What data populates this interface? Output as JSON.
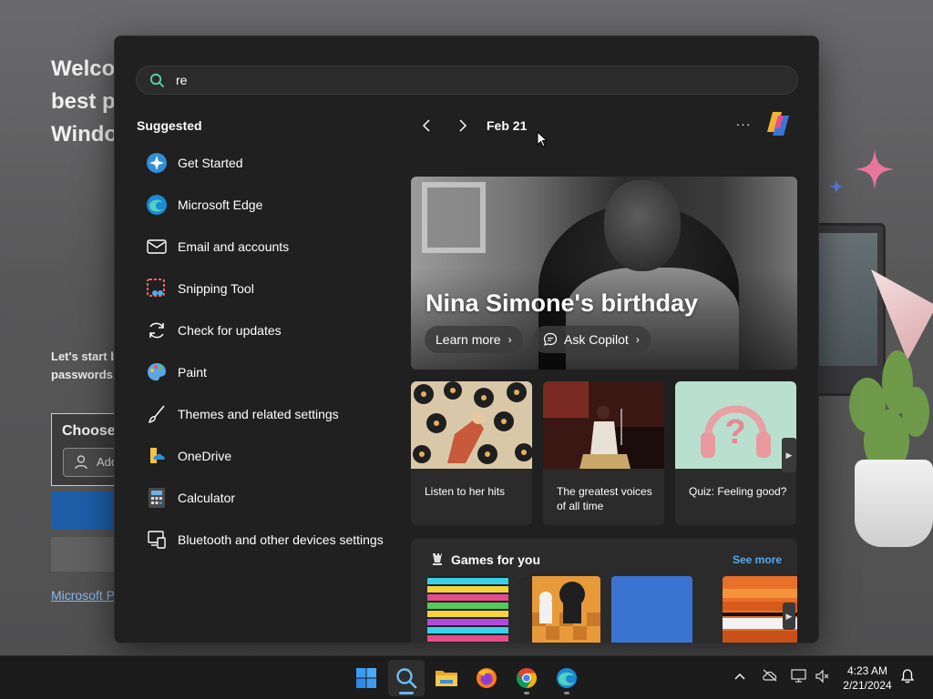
{
  "background_app": {
    "heading": "Welcome to the\nbest place for\nWindows",
    "subtext": "Let's start b\npasswords,",
    "card_title": "Choose",
    "add_button_label": "Add",
    "footer_link": "Microsoft P"
  },
  "search": {
    "query": "re"
  },
  "suggested": {
    "title": "Suggested",
    "items": [
      {
        "label": "Get Started",
        "icon": "get-started-icon"
      },
      {
        "label": "Microsoft Edge",
        "icon": "edge-icon"
      },
      {
        "label": "Email and accounts",
        "icon": "mail-icon"
      },
      {
        "label": "Snipping Tool",
        "icon": "snipping-tool-icon"
      },
      {
        "label": "Check for updates",
        "icon": "refresh-icon"
      },
      {
        "label": "Paint",
        "icon": "paint-icon"
      },
      {
        "label": "Themes and related settings",
        "icon": "brush-icon"
      },
      {
        "label": "OneDrive",
        "icon": "onedrive-icon"
      },
      {
        "label": "Calculator",
        "icon": "calculator-icon"
      },
      {
        "label": "Bluetooth and other devices settings",
        "icon": "devices-icon"
      }
    ]
  },
  "highlights": {
    "date": "Feb 21",
    "more_label": "···",
    "hero": {
      "title": "Nina Simone's birthday",
      "learn_more": "Learn more",
      "ask_copilot": "Ask Copilot"
    },
    "cards": [
      {
        "caption": "Listen to her hits"
      },
      {
        "caption": "The greatest voices of all time"
      },
      {
        "caption": "Quiz: Feeling good?"
      }
    ],
    "games": {
      "title": "Games for you",
      "see_more": "See more"
    }
  },
  "taskbar": {
    "apps": [
      "start-icon",
      "search-icon",
      "file-explorer-icon",
      "firefox-icon",
      "chrome-icon",
      "edge-icon"
    ],
    "time": "4:23 AM",
    "date": "2/21/2024"
  },
  "colors": {
    "flyout_bg": "#202020",
    "accent_link": "#5ba9e8",
    "taskbar_bg": "#1c1c1c"
  }
}
